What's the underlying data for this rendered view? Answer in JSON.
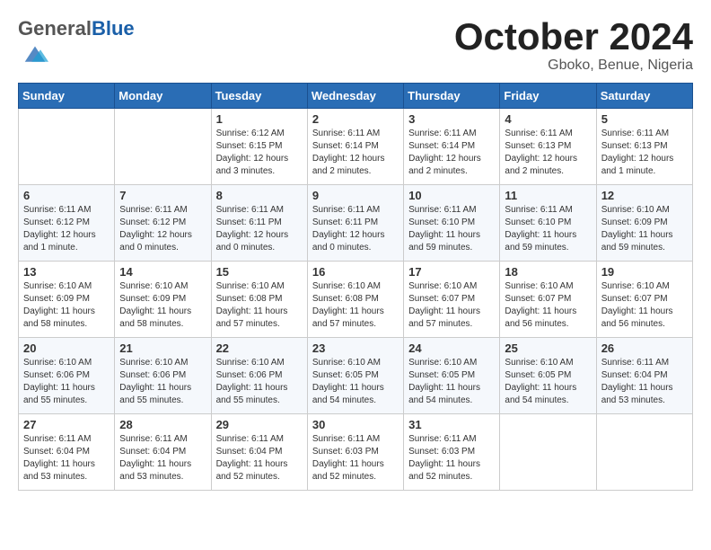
{
  "header": {
    "logo_general": "General",
    "logo_blue": "Blue",
    "month": "October 2024",
    "location": "Gboko, Benue, Nigeria"
  },
  "days_of_week": [
    "Sunday",
    "Monday",
    "Tuesday",
    "Wednesday",
    "Thursday",
    "Friday",
    "Saturday"
  ],
  "weeks": [
    [
      {
        "day": "",
        "info": ""
      },
      {
        "day": "",
        "info": ""
      },
      {
        "day": "1",
        "info": "Sunrise: 6:12 AM\nSunset: 6:15 PM\nDaylight: 12 hours\nand 3 minutes."
      },
      {
        "day": "2",
        "info": "Sunrise: 6:11 AM\nSunset: 6:14 PM\nDaylight: 12 hours\nand 2 minutes."
      },
      {
        "day": "3",
        "info": "Sunrise: 6:11 AM\nSunset: 6:14 PM\nDaylight: 12 hours\nand 2 minutes."
      },
      {
        "day": "4",
        "info": "Sunrise: 6:11 AM\nSunset: 6:13 PM\nDaylight: 12 hours\nand 2 minutes."
      },
      {
        "day": "5",
        "info": "Sunrise: 6:11 AM\nSunset: 6:13 PM\nDaylight: 12 hours\nand 1 minute."
      }
    ],
    [
      {
        "day": "6",
        "info": "Sunrise: 6:11 AM\nSunset: 6:12 PM\nDaylight: 12 hours\nand 1 minute."
      },
      {
        "day": "7",
        "info": "Sunrise: 6:11 AM\nSunset: 6:12 PM\nDaylight: 12 hours\nand 0 minutes."
      },
      {
        "day": "8",
        "info": "Sunrise: 6:11 AM\nSunset: 6:11 PM\nDaylight: 12 hours\nand 0 minutes."
      },
      {
        "day": "9",
        "info": "Sunrise: 6:11 AM\nSunset: 6:11 PM\nDaylight: 12 hours\nand 0 minutes."
      },
      {
        "day": "10",
        "info": "Sunrise: 6:11 AM\nSunset: 6:10 PM\nDaylight: 11 hours\nand 59 minutes."
      },
      {
        "day": "11",
        "info": "Sunrise: 6:11 AM\nSunset: 6:10 PM\nDaylight: 11 hours\nand 59 minutes."
      },
      {
        "day": "12",
        "info": "Sunrise: 6:10 AM\nSunset: 6:09 PM\nDaylight: 11 hours\nand 59 minutes."
      }
    ],
    [
      {
        "day": "13",
        "info": "Sunrise: 6:10 AM\nSunset: 6:09 PM\nDaylight: 11 hours\nand 58 minutes."
      },
      {
        "day": "14",
        "info": "Sunrise: 6:10 AM\nSunset: 6:09 PM\nDaylight: 11 hours\nand 58 minutes."
      },
      {
        "day": "15",
        "info": "Sunrise: 6:10 AM\nSunset: 6:08 PM\nDaylight: 11 hours\nand 57 minutes."
      },
      {
        "day": "16",
        "info": "Sunrise: 6:10 AM\nSunset: 6:08 PM\nDaylight: 11 hours\nand 57 minutes."
      },
      {
        "day": "17",
        "info": "Sunrise: 6:10 AM\nSunset: 6:07 PM\nDaylight: 11 hours\nand 57 minutes."
      },
      {
        "day": "18",
        "info": "Sunrise: 6:10 AM\nSunset: 6:07 PM\nDaylight: 11 hours\nand 56 minutes."
      },
      {
        "day": "19",
        "info": "Sunrise: 6:10 AM\nSunset: 6:07 PM\nDaylight: 11 hours\nand 56 minutes."
      }
    ],
    [
      {
        "day": "20",
        "info": "Sunrise: 6:10 AM\nSunset: 6:06 PM\nDaylight: 11 hours\nand 55 minutes."
      },
      {
        "day": "21",
        "info": "Sunrise: 6:10 AM\nSunset: 6:06 PM\nDaylight: 11 hours\nand 55 minutes."
      },
      {
        "day": "22",
        "info": "Sunrise: 6:10 AM\nSunset: 6:06 PM\nDaylight: 11 hours\nand 55 minutes."
      },
      {
        "day": "23",
        "info": "Sunrise: 6:10 AM\nSunset: 6:05 PM\nDaylight: 11 hours\nand 54 minutes."
      },
      {
        "day": "24",
        "info": "Sunrise: 6:10 AM\nSunset: 6:05 PM\nDaylight: 11 hours\nand 54 minutes."
      },
      {
        "day": "25",
        "info": "Sunrise: 6:10 AM\nSunset: 6:05 PM\nDaylight: 11 hours\nand 54 minutes."
      },
      {
        "day": "26",
        "info": "Sunrise: 6:11 AM\nSunset: 6:04 PM\nDaylight: 11 hours\nand 53 minutes."
      }
    ],
    [
      {
        "day": "27",
        "info": "Sunrise: 6:11 AM\nSunset: 6:04 PM\nDaylight: 11 hours\nand 53 minutes."
      },
      {
        "day": "28",
        "info": "Sunrise: 6:11 AM\nSunset: 6:04 PM\nDaylight: 11 hours\nand 53 minutes."
      },
      {
        "day": "29",
        "info": "Sunrise: 6:11 AM\nSunset: 6:04 PM\nDaylight: 11 hours\nand 52 minutes."
      },
      {
        "day": "30",
        "info": "Sunrise: 6:11 AM\nSunset: 6:03 PM\nDaylight: 11 hours\nand 52 minutes."
      },
      {
        "day": "31",
        "info": "Sunrise: 6:11 AM\nSunset: 6:03 PM\nDaylight: 11 hours\nand 52 minutes."
      },
      {
        "day": "",
        "info": ""
      },
      {
        "day": "",
        "info": ""
      }
    ]
  ]
}
